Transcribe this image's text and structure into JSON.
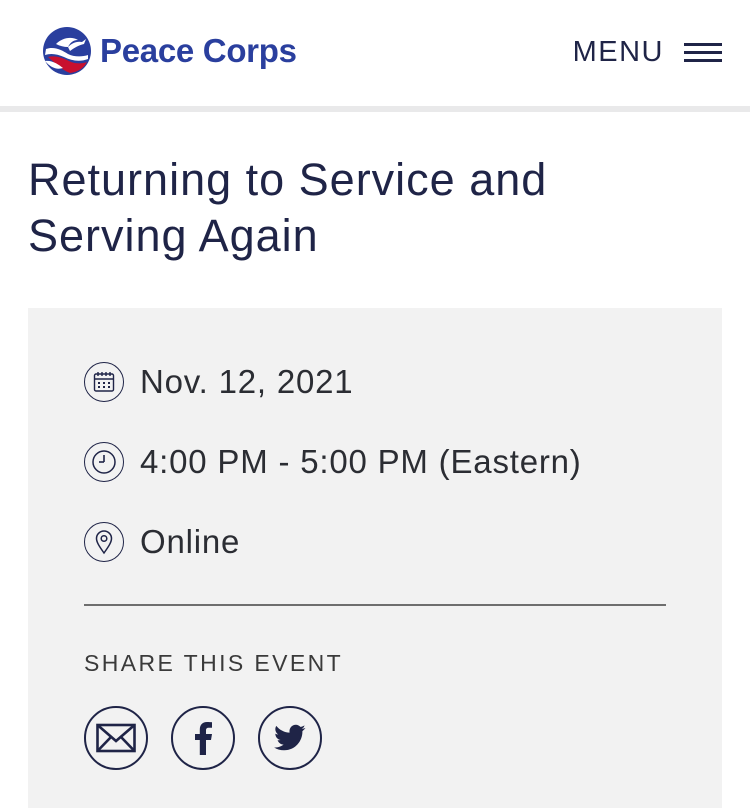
{
  "header": {
    "logo_text": "Peace Corps",
    "menu_label": "MENU",
    "brand_colors": {
      "blue": "#2a3f9e",
      "red": "#c8102e"
    }
  },
  "event": {
    "title": "Returning to Service and Serving Again",
    "date": "Nov. 12, 2021",
    "time": "4:00 PM - 5:00 PM (Eastern)",
    "location": "Online",
    "icons": {
      "date": "calendar-icon",
      "time": "clock-icon",
      "location": "map-pin-icon"
    }
  },
  "share": {
    "label": "SHARE THIS EVENT",
    "buttons": [
      {
        "name": "email",
        "icon": "envelope-icon"
      },
      {
        "name": "facebook",
        "icon": "facebook-icon"
      },
      {
        "name": "twitter",
        "icon": "twitter-icon"
      }
    ]
  }
}
